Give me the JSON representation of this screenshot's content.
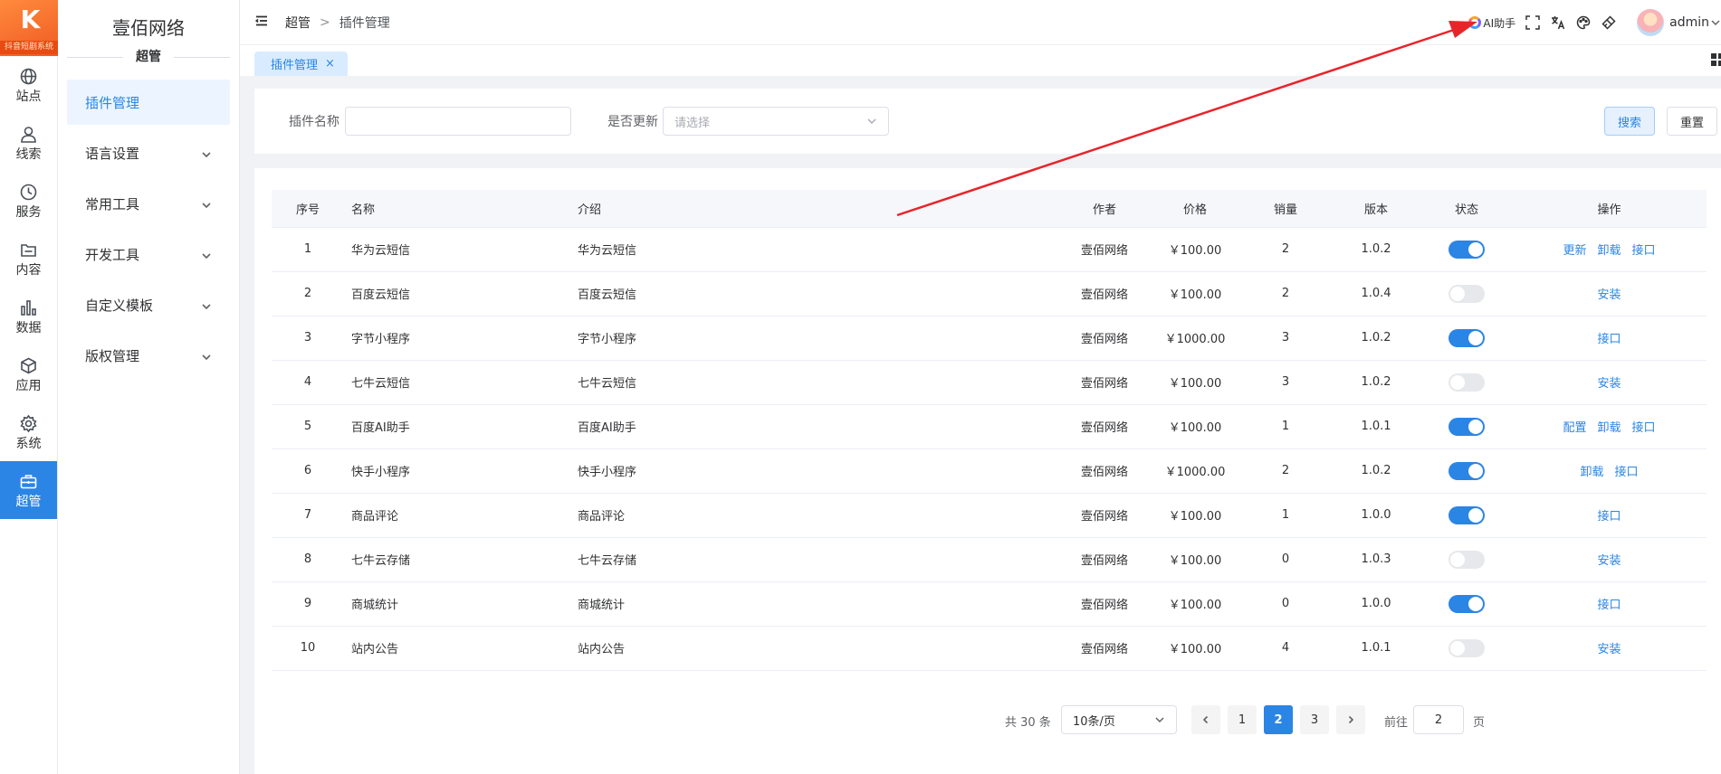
{
  "logo": {
    "mark": "K",
    "sub_text": "抖音短剧系统"
  },
  "rail": [
    {
      "key": "site",
      "label": "站点",
      "icon": "globe-icon",
      "active": false
    },
    {
      "key": "clue",
      "label": "线索",
      "icon": "person-icon",
      "active": false
    },
    {
      "key": "service",
      "label": "服务",
      "icon": "clock-icon",
      "active": false
    },
    {
      "key": "content",
      "label": "内容",
      "icon": "folder-icon",
      "active": false
    },
    {
      "key": "data",
      "label": "数据",
      "icon": "bar-chart-icon",
      "active": false
    },
    {
      "key": "app",
      "label": "应用",
      "icon": "cube-icon",
      "active": false
    },
    {
      "key": "system",
      "label": "系统",
      "icon": "gear-icon",
      "active": false
    },
    {
      "key": "super",
      "label": "超管",
      "icon": "briefcase-icon",
      "active": true
    }
  ],
  "submenu": {
    "site_name": "壹佰网络",
    "section": "超管",
    "items": [
      {
        "label": "插件管理",
        "active": true,
        "has_children": false
      },
      {
        "label": "语言设置",
        "active": false,
        "has_children": true
      },
      {
        "label": "常用工具",
        "active": false,
        "has_children": true
      },
      {
        "label": "开发工具",
        "active": false,
        "has_children": true
      },
      {
        "label": "自定义模板",
        "active": false,
        "has_children": true
      },
      {
        "label": "版权管理",
        "active": false,
        "has_children": true
      }
    ]
  },
  "header": {
    "breadcrumb": [
      "超管",
      "插件管理"
    ],
    "separator": ">",
    "ai_label": "AI助手",
    "user": "admin"
  },
  "tabs": [
    {
      "label": "插件管理",
      "close": "×",
      "active": true
    }
  ],
  "search": {
    "name_label": "插件名称",
    "name_value": "",
    "update_label": "是否更新",
    "update_placeholder": "请选择",
    "search_button": "搜索",
    "reset_button": "重置"
  },
  "table": {
    "columns": [
      "序号",
      "名称",
      "介绍",
      "作者",
      "价格",
      "销量",
      "版本",
      "状态",
      "操作"
    ],
    "rows": [
      {
        "no": "1",
        "name": "华为云短信",
        "intro": "华为云短信",
        "author": "壹佰网络",
        "price": "￥100.00",
        "sales": "2",
        "version": "1.0.2",
        "enabled": true,
        "actions": [
          "更新",
          "卸载",
          "接口"
        ]
      },
      {
        "no": "2",
        "name": "百度云短信",
        "intro": "百度云短信",
        "author": "壹佰网络",
        "price": "￥100.00",
        "sales": "2",
        "version": "1.0.4",
        "enabled": false,
        "actions": [
          "安装"
        ]
      },
      {
        "no": "3",
        "name": "字节小程序",
        "intro": "字节小程序",
        "author": "壹佰网络",
        "price": "￥1000.00",
        "sales": "3",
        "version": "1.0.2",
        "enabled": true,
        "actions": [
          "接口"
        ]
      },
      {
        "no": "4",
        "name": "七牛云短信",
        "intro": "七牛云短信",
        "author": "壹佰网络",
        "price": "￥100.00",
        "sales": "3",
        "version": "1.0.2",
        "enabled": false,
        "actions": [
          "安装"
        ]
      },
      {
        "no": "5",
        "name": "百度AI助手",
        "intro": "百度AI助手",
        "author": "壹佰网络",
        "price": "￥100.00",
        "sales": "1",
        "version": "1.0.1",
        "enabled": true,
        "actions": [
          "配置",
          "卸载",
          "接口"
        ]
      },
      {
        "no": "6",
        "name": "快手小程序",
        "intro": "快手小程序",
        "author": "壹佰网络",
        "price": "￥1000.00",
        "sales": "2",
        "version": "1.0.2",
        "enabled": true,
        "actions": [
          "卸载",
          "接口"
        ]
      },
      {
        "no": "7",
        "name": "商品评论",
        "intro": "商品评论",
        "author": "壹佰网络",
        "price": "￥100.00",
        "sales": "1",
        "version": "1.0.0",
        "enabled": true,
        "actions": [
          "接口"
        ]
      },
      {
        "no": "8",
        "name": "七牛云存储",
        "intro": "七牛云存储",
        "author": "壹佰网络",
        "price": "￥100.00",
        "sales": "0",
        "version": "1.0.3",
        "enabled": false,
        "actions": [
          "安装"
        ]
      },
      {
        "no": "9",
        "name": "商城统计",
        "intro": "商城统计",
        "author": "壹佰网络",
        "price": "￥100.00",
        "sales": "0",
        "version": "1.0.0",
        "enabled": true,
        "actions": [
          "接口"
        ]
      },
      {
        "no": "10",
        "name": "站内公告",
        "intro": "站内公告",
        "author": "壹佰网络",
        "price": "￥100.00",
        "sales": "4",
        "version": "1.0.1",
        "enabled": false,
        "actions": [
          "安装"
        ]
      }
    ]
  },
  "pagination": {
    "total_text": "共 30 条",
    "page_size": "10条/页",
    "pages": [
      "1",
      "2",
      "3"
    ],
    "current_page": "2",
    "goto_label": "前往",
    "goto_value": "2",
    "goto_suffix": "页"
  },
  "colors": {
    "primary": "#2b85e4",
    "annotation_arrow": "#e8242b",
    "logo": "#f05a23"
  }
}
